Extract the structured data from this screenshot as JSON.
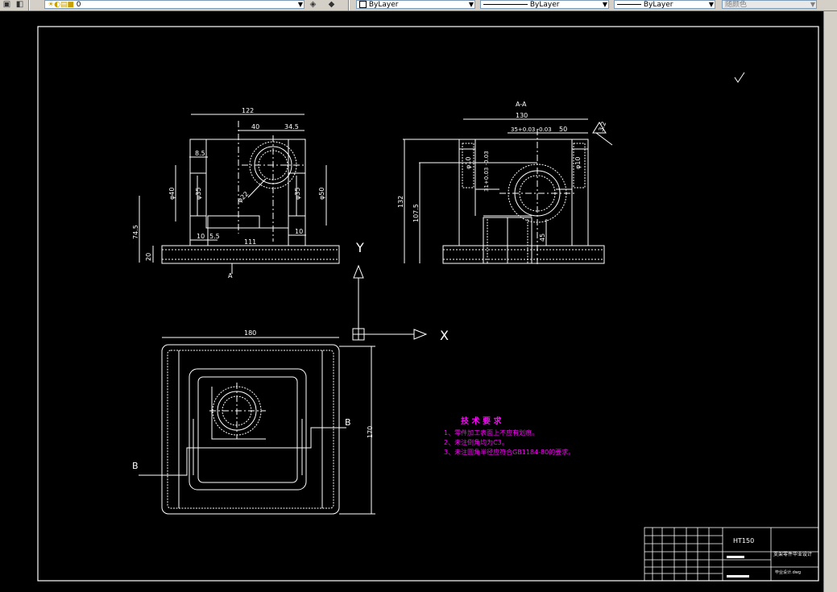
{
  "toolbar": {
    "layer_value": "0",
    "color_value": "ByLayer",
    "linetype_value": "ByLayer",
    "lineweight_value": "ByLayer",
    "plotstyle_value": "随颜色"
  },
  "drawing": {
    "view_labels": {
      "section_title": "A-A",
      "cut_a": "A",
      "cut_b_left": "B",
      "cut_b_right": "B"
    },
    "axis": {
      "y_label": "Y",
      "x_label": "X"
    },
    "front_dims": [
      "122",
      "40",
      "34.5",
      "8.5",
      "φ40",
      "φ35",
      "φ22",
      "φ35",
      "φ50",
      "74.5",
      "20",
      "10",
      "5.5",
      "111",
      "10"
    ],
    "section_dims": [
      "130",
      "35+0.03 -0.03",
      "50",
      "3.2",
      "φ10",
      "31+0.03 -0.03",
      "φ10",
      "132",
      "107.5",
      "45"
    ],
    "plan_dims": [
      "180",
      "170"
    ],
    "roughness": "3.2",
    "tech_req": {
      "title": "技 术 要 求",
      "items": [
        "1、零件加工表面上不应有划痕。",
        "2、未注倒角均为C3。",
        "3、未注圆角半径应符合GB1184-80的要求。"
      ]
    },
    "title_block": {
      "material": "HT150",
      "part_name": "支架零件毕业设计",
      "company": "毕业设计.dwg"
    }
  },
  "colors": {
    "background": "#000000",
    "lines": "#ffffff",
    "annotation": "#ff00ff",
    "toolbar": "#d4d0c8"
  }
}
